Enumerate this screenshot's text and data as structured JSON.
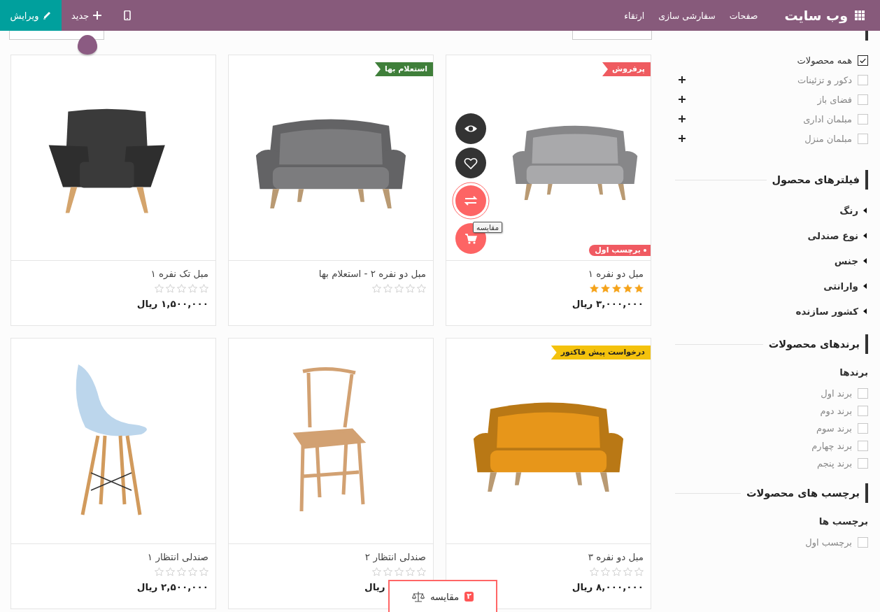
{
  "top_bar": {
    "site_title": "وب سایت",
    "menu": [
      "صفحات",
      "سفارشی سازی",
      "ارتقاء"
    ],
    "new_button": "جدید",
    "edit_button": "ویرایش"
  },
  "sidebar": {
    "categories": [
      {
        "label": "همه محصولات",
        "checked": true,
        "expandable": false
      },
      {
        "label": "دکور و تزئینات",
        "checked": false,
        "expandable": true
      },
      {
        "label": "فضای باز",
        "checked": false,
        "expandable": true
      },
      {
        "label": "مبلمان اداری",
        "checked": false,
        "expandable": true
      },
      {
        "label": "مبلمان منزل",
        "checked": false,
        "expandable": true
      }
    ],
    "filters_title": "فیلترهای محصول",
    "filters": [
      {
        "label": "رنگ",
        "expanded": false
      },
      {
        "label": "نوع صندلی",
        "expanded": false
      },
      {
        "label": "جنس",
        "expanded": false
      },
      {
        "label": "وارانتی",
        "expanded": false
      },
      {
        "label": "کشور سازنده",
        "expanded": false
      }
    ],
    "sections": [
      {
        "title": "برندهای محصولات",
        "subtitle": "برندها",
        "options": [
          {
            "label": "برند اول",
            "checked": false
          },
          {
            "label": "برند دوم",
            "checked": false
          },
          {
            "label": "برند سوم",
            "checked": false
          },
          {
            "label": "برند چهارم",
            "checked": false
          },
          {
            "label": "برند پنجم",
            "checked": false
          }
        ]
      },
      {
        "title": "برچسب های محصولات",
        "subtitle": "برچسب ها",
        "options": [
          {
            "label": "برچسب اول",
            "checked": false
          }
        ]
      }
    ]
  },
  "products": [
    {
      "name": "مبل دو نفره ۱",
      "stars": 5,
      "price": "۳,۰۰۰,۰۰۰ ریال",
      "kind": "sofa",
      "color": "#a9a9ab",
      "ribbon": {
        "text": "پرفروش",
        "color": "#ef5b60"
      },
      "tag": "برچسب اول",
      "hover": true,
      "tooltip": "مقایسه"
    },
    {
      "name": "مبل دو نفره ۲ - استعلام بها",
      "stars": 0,
      "kind": "sofa",
      "color": "#7c7c7e",
      "ribbon": {
        "text": "استعلام بها",
        "color": "#3f7f3a"
      },
      "hover": false
    },
    {
      "name": "مبل تک نفره ۱",
      "stars": 0,
      "price": "۱,۵۰۰,۰۰۰ ریال",
      "kind": "armchair",
      "color": "#3a3a3a",
      "hover": false
    },
    {
      "name": "مبل دو نفره ۳",
      "stars": 0,
      "price": "۸,۰۰۰,۰۰۰ ریال",
      "kind": "sofa",
      "color": "#e7961a",
      "ribbon": {
        "text": "درخواست پیش فاکتور",
        "color": "#f4c20d"
      },
      "hover": false
    },
    {
      "name": "صندلی انتظار ۲",
      "stars": 0,
      "price": "ریال",
      "kind": "chair",
      "color": "#d2a172",
      "hover": false
    },
    {
      "name": "صندلی انتظار ۱",
      "stars": 0,
      "price": "۲,۵۰۰,۰۰۰ ریال",
      "kind": "shell-chair",
      "color": "#bcd6ec",
      "hover": false
    }
  ],
  "compare_bar": {
    "label": "مقایسه",
    "count": "۲"
  }
}
